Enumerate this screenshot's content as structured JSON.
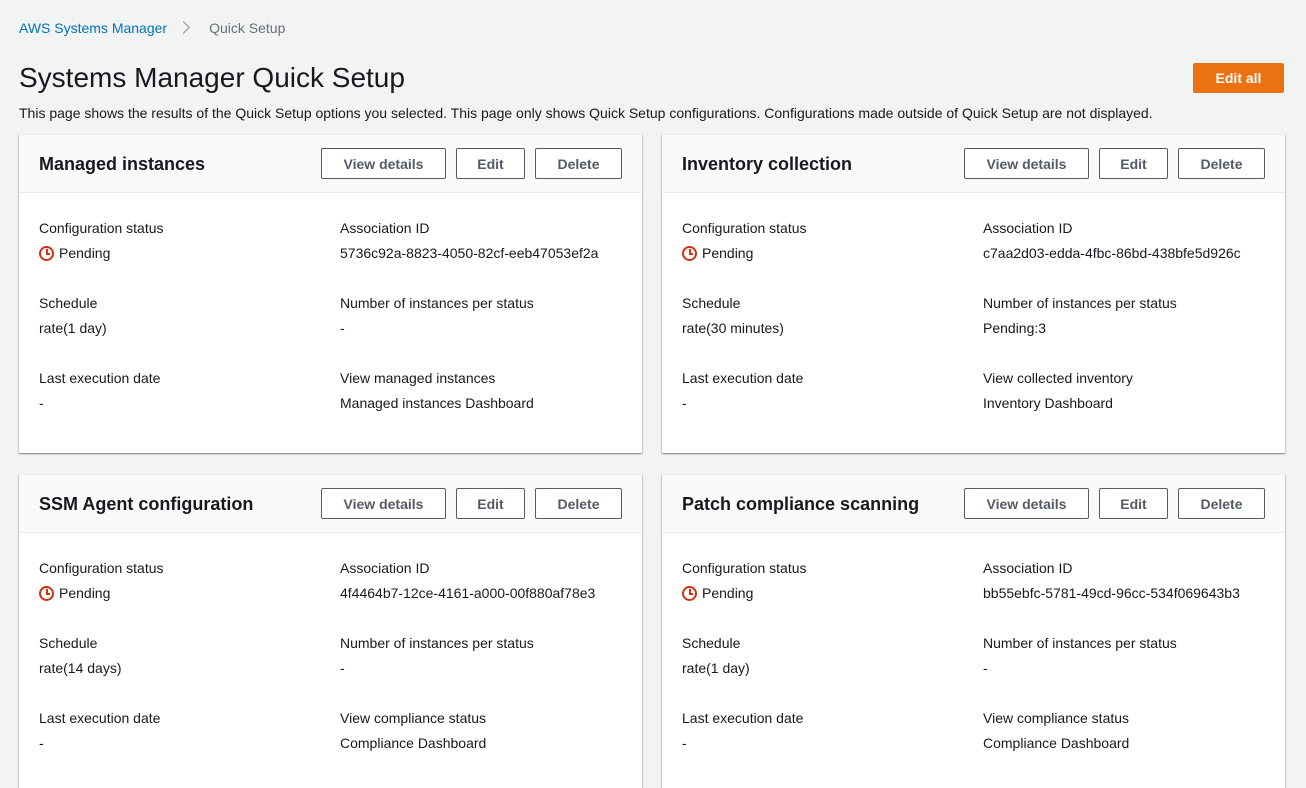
{
  "breadcrumb": {
    "parent": "AWS Systems Manager",
    "current": "Quick Setup"
  },
  "page": {
    "title": "Systems Manager Quick Setup",
    "description": "This page shows the results of the Quick Setup options you selected. This page only shows Quick Setup configurations. Configurations made outside of Quick Setup are not displayed.",
    "edit_all_label": "Edit all"
  },
  "colors": {
    "accent": "#ec7211",
    "link": "#0073bb",
    "pending": "#d13212"
  },
  "labels": {
    "view_details": "View details",
    "edit": "Edit",
    "delete": "Delete",
    "config_status": "Configuration status",
    "association_id": "Association ID",
    "schedule": "Schedule",
    "instances_per_status": "Number of instances per status",
    "last_execution": "Last execution date"
  },
  "cards": [
    {
      "title": "Managed instances",
      "status": "Pending",
      "association_id": "5736c92a-8823-4050-82cf-eeb47053ef2a",
      "schedule": "rate(1 day)",
      "instances_per_status": "-",
      "last_execution": "-",
      "view_label": "View managed instances",
      "view_link": "Managed instances Dashboard"
    },
    {
      "title": "Inventory collection",
      "status": "Pending",
      "association_id": "c7aa2d03-edda-4fbc-86bd-438bfe5d926c",
      "schedule": "rate(30 minutes)",
      "instances_per_status": "Pending:3",
      "last_execution": "-",
      "view_label": "View collected inventory",
      "view_link": "Inventory Dashboard"
    },
    {
      "title": "SSM Agent configuration",
      "status": "Pending",
      "association_id": "4f4464b7-12ce-4161-a000-00f880af78e3",
      "schedule": "rate(14 days)",
      "instances_per_status": "-",
      "last_execution": "-",
      "view_label": "View compliance status",
      "view_link": "Compliance Dashboard"
    },
    {
      "title": "Patch compliance scanning",
      "status": "Pending",
      "association_id": "bb55ebfc-5781-49cd-96cc-534f069643b3",
      "schedule": "rate(1 day)",
      "instances_per_status": "-",
      "last_execution": "-",
      "view_label": "View compliance status",
      "view_link": "Compliance Dashboard"
    }
  ]
}
